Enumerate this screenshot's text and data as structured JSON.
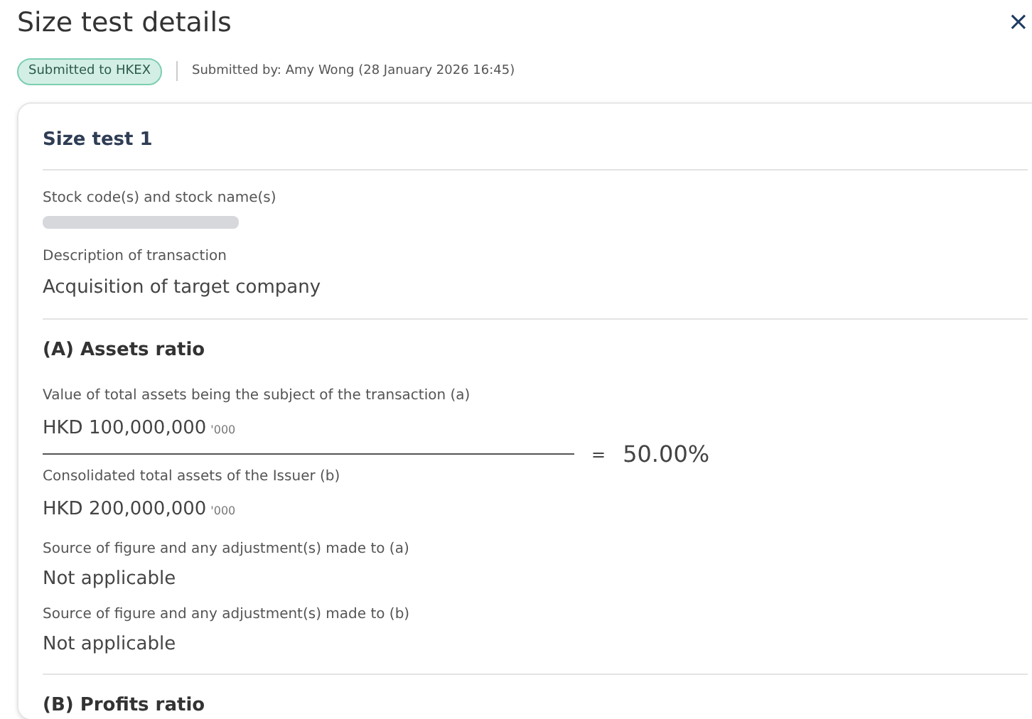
{
  "title": "Size test details",
  "close": "×",
  "status_badge": "Submitted to HKEX",
  "submitted_by": "Submitted by: Amy Wong (28 January 2026 16:45)",
  "card": {
    "title": "Size test 1",
    "fields": [
      {
        "kind": "blurred",
        "label": "Stock code(s) and stock name(s)"
      },
      {
        "kind": "text",
        "label": "Description of transaction",
        "value": "Acquisition of target company"
      }
    ],
    "sections": [
      {
        "heading": "(A) Assets ratio",
        "numerator": {
          "label": "Value of total assets being the subject of the transaction (a)",
          "value": "HKD 100,000,000",
          "unit": "'000"
        },
        "denominator": {
          "label": "Consolidated total assets of the Issuer (b)",
          "value": "HKD 200,000,000",
          "unit": "'000"
        },
        "equals": "=",
        "result": "50.00%",
        "notes": [
          {
            "label": "Source of figure and any adjustment(s) made to (a)",
            "value": "Not applicable"
          },
          {
            "label": "Source of figure and any adjustment(s) made to (b)",
            "value": "Not applicable"
          }
        ]
      },
      {
        "heading": "(B) Profits ratio"
      }
    ]
  }
}
